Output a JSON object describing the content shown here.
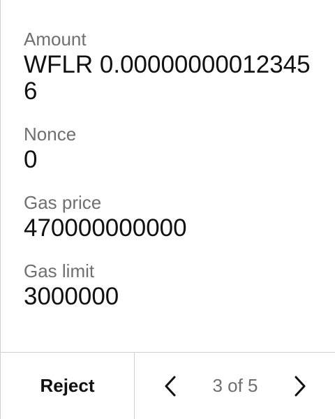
{
  "fields": [
    {
      "label": "Amount",
      "value": "WFLR 0.000000000123456"
    },
    {
      "label": "Nonce",
      "value": "0"
    },
    {
      "label": "Gas price",
      "value": "470000000000"
    },
    {
      "label": "Gas limit",
      "value": "3000000"
    }
  ],
  "footer": {
    "reject_label": "Reject",
    "page_indicator": "3 of 5",
    "prev_icon": "chevron-left-icon",
    "next_icon": "chevron-right-icon"
  }
}
